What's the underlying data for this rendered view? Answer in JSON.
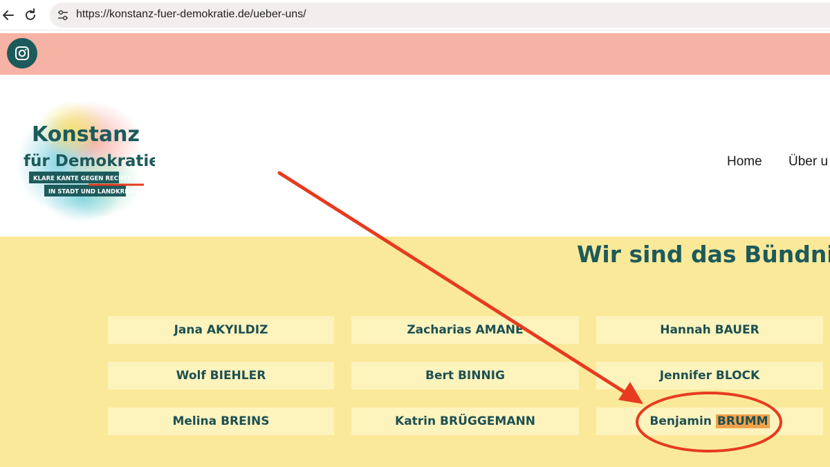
{
  "browser": {
    "url": "https://konstanz-fuer-demokratie.de/ueber-uns/",
    "back_icon": "arrow-left-icon",
    "reload_icon": "reload-icon",
    "site_info_icon": "tune-icon"
  },
  "social": {
    "icon": "instagram-icon",
    "color": "#1d5a5b"
  },
  "logo": {
    "line1": "Konstanz",
    "line2": "für Demokratie",
    "tag1": "KLARE KANTE GEGEN RECHTS",
    "tag2": "IN STADT UND LANDKREIS"
  },
  "nav": {
    "home": "Home",
    "ueber": "Über u"
  },
  "main": {
    "title": "Wir sind das Bündni"
  },
  "members": [
    {
      "first": "Jana",
      "last": "AKYILDIZ"
    },
    {
      "first": "Zacharias",
      "last": "AMANE"
    },
    {
      "first": "Hannah",
      "last": "BAUER"
    },
    {
      "first": "Wolf",
      "last": "BIEHLER"
    },
    {
      "first": "Bert",
      "last": "BINNIG"
    },
    {
      "first": "Jennifer",
      "last": "BLOCK"
    },
    {
      "first": "Melina",
      "last": "BREINS"
    },
    {
      "first": "Katrin",
      "last": "BRÜGGEMANN"
    },
    {
      "first": "Benjamin",
      "last": "BRUMM"
    }
  ],
  "colors": {
    "accent_teal": "#1d5a5b",
    "social_bar": "#f6b2a4",
    "section_bg": "#fbe99a",
    "card_bg": "#fdf3bd",
    "highlight": "#f2a24b",
    "annotation_red": "#e63b1e"
  }
}
